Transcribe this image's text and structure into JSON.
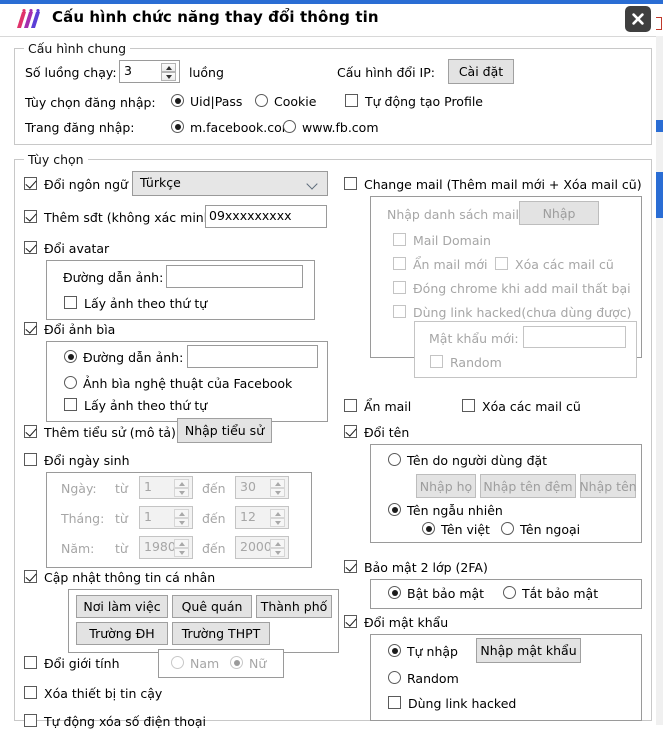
{
  "window": {
    "title": "Cấu hình chức năng thay đổi thông tin",
    "logo_icon": "app-logo-icon",
    "close_icon": "close-icon",
    "accent_color": "#2a6dd4"
  },
  "general": {
    "legend": "Cấu hình chung",
    "threads_label": "Số luồng chạy:",
    "threads_value": "3",
    "threads_unit": "luồng",
    "ip_label": "Cấu hình đổi IP:",
    "ip_button": "Cài đặt",
    "auto_profile": "Tự động tạo Profile",
    "login_option_label": "Tùy chọn đăng nhập:",
    "login_uidpass": "Uid|Pass",
    "login_cookie": "Cookie",
    "login_page_label": "Trang đăng nhập:",
    "page_m": "m.facebook.com",
    "page_www": "www.fb.com"
  },
  "options": {
    "legend": "Tùy chọn",
    "change_language": "Đổi ngôn ngữ",
    "language_value": "Türkçe",
    "add_phone": "Thêm sđt (không xác minh)",
    "phone_value": "09xxxxxxxxx",
    "change_avatar": "Đổi avatar",
    "avatar_path_label": "Đường dẫn ảnh:",
    "avatar_path_value": "",
    "avatar_order": "Lấy ảnh theo thứ tự",
    "change_cover": "Đổi ảnh bìa",
    "cover_path_label": "Đường dẫn ảnh:",
    "cover_path_value": "",
    "cover_fb_art": "Ảnh bìa nghệ thuật của Facebook",
    "cover_order": "Lấy ảnh theo thứ tự",
    "add_bio": "Thêm tiểu sử (mô tả)",
    "bio_button": "Nhập tiểu sử",
    "change_birthday": "Đổi ngày sinh",
    "day_label": "Ngày:",
    "month_label": "Tháng:",
    "year_label": "Năm:",
    "from_label": "từ",
    "to_label": "đến",
    "day_from": "1",
    "day_to": "30",
    "month_from": "1",
    "month_to": "12",
    "year_from": "1980",
    "year_to": "2000",
    "update_personal": "Cập nhật thông tin cá nhân",
    "work_button": "Nơi làm việc",
    "hometown_button": "Quê quán",
    "city_button": "Thành phố",
    "university_button": "Trường ĐH",
    "highschool_button": "Trường THPT",
    "change_gender": "Đổi giới tính",
    "gender_male": "Nam",
    "gender_female": "Nữ",
    "remove_trusted_device": "Xóa thiết bị tin cậy",
    "auto_remove_phone": "Tự động xóa số điện thoại"
  },
  "mail": {
    "change_mail": "Change mail (Thêm mail mới + Xóa mail cũ)",
    "mail_list_label": "Nhập danh sách mail:",
    "mail_list_button": "Nhập",
    "mail_domain": "Mail Domain",
    "hide_new_mail": "Ẩn mail mới",
    "delete_old_mails": "Xóa các mail cũ",
    "close_chrome_fail": "Đóng chrome khi add mail thất bại",
    "use_hacked_link": "Dùng link hacked(chưa dùng được)",
    "new_password_label": "Mật khẩu mới:",
    "new_password_value": "",
    "random": "Random",
    "hide_mail": "Ẩn mail",
    "delete_old_mails_2": "Xóa các mail cũ"
  },
  "name": {
    "change_name": "Đổi tên",
    "custom_name": "Tên do người dùng đặt",
    "first_button": "Nhập họ",
    "middle_button": "Nhập tên đệm",
    "last_button": "Nhập tên",
    "random_name": "Tên ngẫu nhiên",
    "vietnamese_name": "Tên việt",
    "foreign_name": "Tên ngoại"
  },
  "security": {
    "two_fa": "Bảo mật 2 lớp (2FA)",
    "enable": "Bật bảo mật",
    "disable": "Tắt bảo mật",
    "change_password": "Đổi mật khẩu",
    "manual": "Tự nhập",
    "password_button": "Nhập mật khẩu",
    "random": "Random",
    "hacked_link": "Dùng link hacked"
  }
}
